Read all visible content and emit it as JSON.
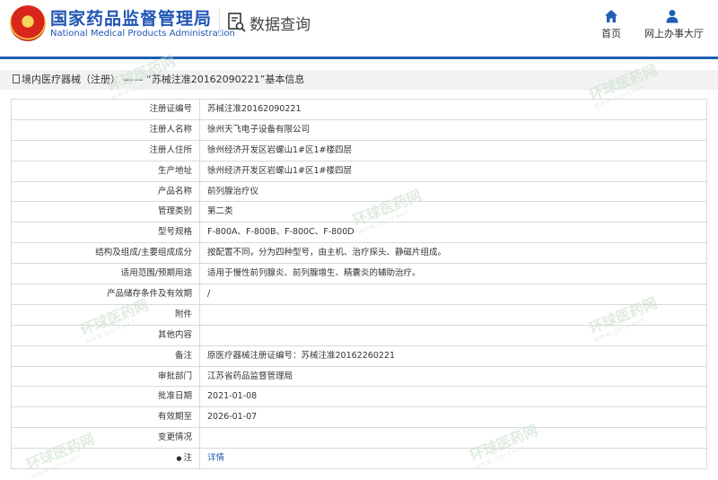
{
  "header": {
    "brand_cn": "国家药品监督管理局",
    "brand_en": "National Medical Products Administration",
    "query_title": "数据查询",
    "nav": [
      {
        "label": "首页",
        "icon": "home-icon"
      },
      {
        "label": "网上办事大厅",
        "icon": "user-icon"
      }
    ]
  },
  "breadcrumb": {
    "text": "境内医疗器械（注册） —— “苏械注准20162090221”基本信息"
  },
  "rows": [
    {
      "label": "注册证编号",
      "value": "苏械注准20162090221"
    },
    {
      "label": "注册人名称",
      "value": "徐州天飞电子设备有限公司"
    },
    {
      "label": "注册人住所",
      "value": "徐州经济开发区岩螺山1#区1#楼四层"
    },
    {
      "label": "生产地址",
      "value": "徐州经济开发区岩螺山1#区1#楼四层"
    },
    {
      "label": "产品名称",
      "value": "前列腺治疗仪"
    },
    {
      "label": "管理类别",
      "value": "第二类"
    },
    {
      "label": "型号规格",
      "value": "F-800A、F-800B、F-800C、F-800D"
    },
    {
      "label": "结构及组成/主要组成成分",
      "value": "按配置不同，分为四种型号，由主机、治疗探头、静磁片组成。"
    },
    {
      "label": "适用范围/预期用途",
      "value": "适用于慢性前列腺炎、前列腺增生、精囊炎的辅助治疗。"
    },
    {
      "label": "产品储存条件及有效期",
      "value": "/"
    },
    {
      "label": "附件",
      "value": ""
    },
    {
      "label": "其他内容",
      "value": ""
    },
    {
      "label": "备注",
      "value": "原医疗器械注册证编号：苏械注准20162260221"
    },
    {
      "label": "审批部门",
      "value": "江苏省药品监督管理局"
    },
    {
      "label": "批准日期",
      "value": "2021-01-08"
    },
    {
      "label": "有效期至",
      "value": "2026-01-07"
    },
    {
      "label": "变更情况",
      "value": ""
    },
    {
      "label": "注",
      "value": "详情"
    }
  ],
  "watermark": {
    "text": "环球医药网",
    "url": "WWW.QQYY.NET"
  }
}
